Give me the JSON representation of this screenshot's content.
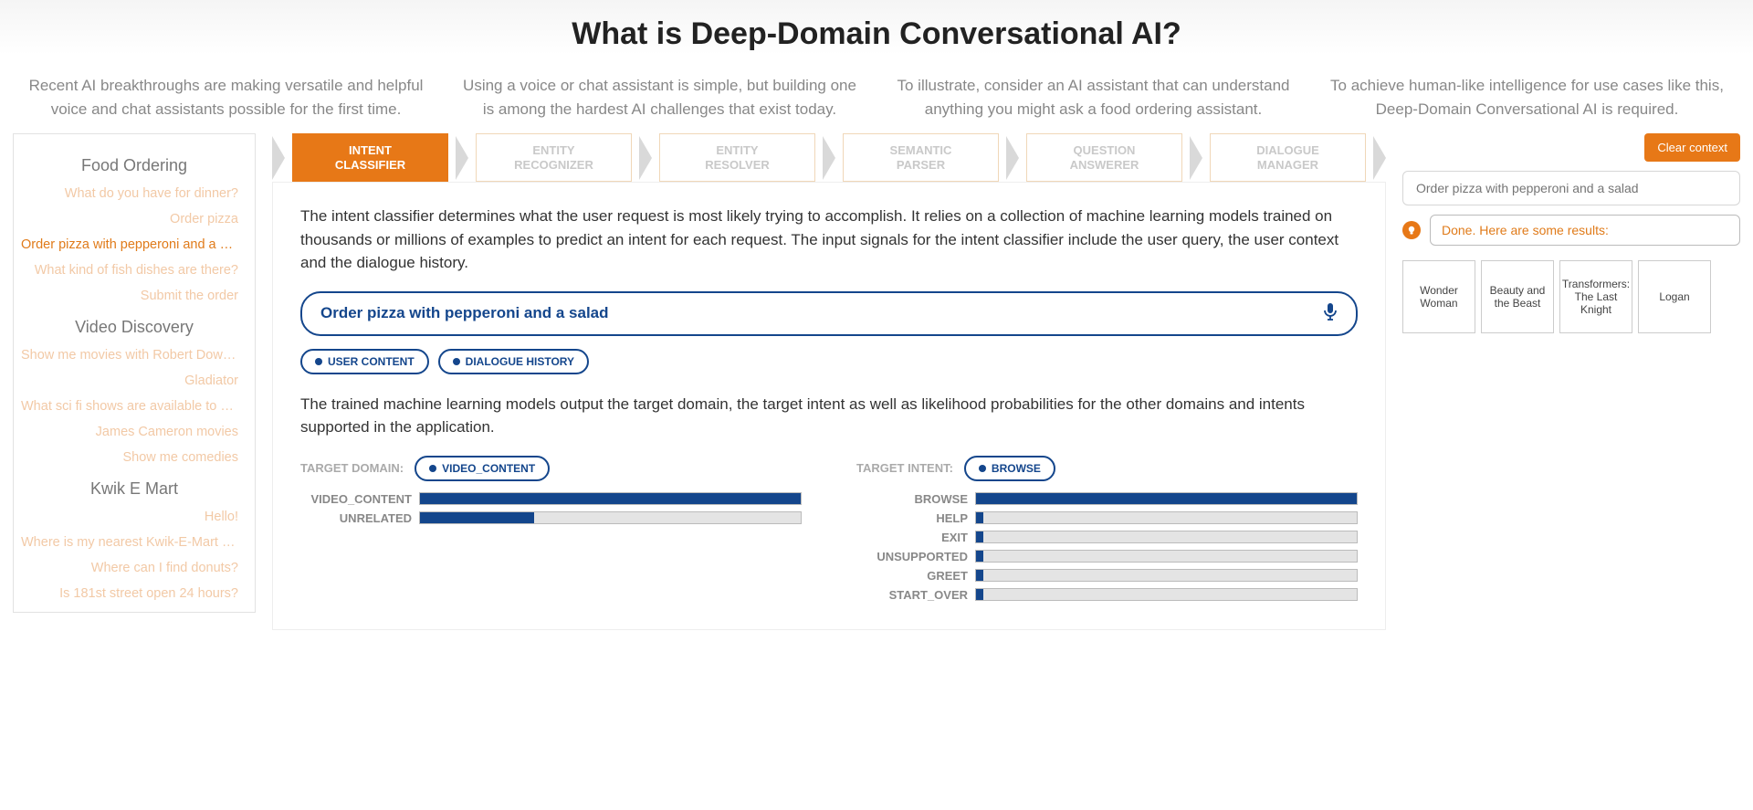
{
  "title": "What is Deep-Domain Conversational AI?",
  "intro": [
    "Recent AI breakthroughs are making versatile and helpful voice and chat assistants possible for the first time.",
    "Using a voice or chat assistant is simple, but building one is among the hardest AI challenges that exist today.",
    "To illustrate, consider an AI assistant that can understand anything you might ask a food ordering assistant.",
    "To achieve human-like intelligence for use cases like this, Deep-Domain Conversational AI is required."
  ],
  "sidebar": {
    "sections": [
      {
        "title": "Food Ordering",
        "items": [
          "What do you have for dinner?",
          "Order pizza",
          "Order pizza with pepperoni and a salad",
          "What kind of fish dishes are there?",
          "Submit the order"
        ],
        "active_index": 2
      },
      {
        "title": "Video Discovery",
        "items": [
          "Show me movies with Robert Downey Jr",
          "Gladiator",
          "What sci fi shows are available to watch?",
          "James Cameron movies",
          "Show me comedies"
        ]
      },
      {
        "title": "Kwik E Mart",
        "items": [
          "Hello!",
          "Where is my nearest Kwik-E-Mart store?",
          "Where can I find donuts?",
          "Is 181st street open 24 hours?"
        ]
      }
    ]
  },
  "pipeline": {
    "stages": [
      "INTENT CLASSIFIER",
      "ENTITY RECOGNIZER",
      "ENTITY RESOLVER",
      "SEMANTIC PARSER",
      "QUESTION ANSWERER",
      "DIALOGUE MANAGER"
    ],
    "active_index": 0
  },
  "panel": {
    "desc1": "The intent classifier determines what the user request is most likely trying to accomplish. It relies on a collection of machine learning models trained on thousands or millions of examples to predict an intent for each request. The input signals for the intent classifier include the user query, the user context and the dialogue history.",
    "query": "Order pizza with pepperoni and a salad",
    "pills": [
      "USER CONTENT",
      "DIALOGUE HISTORY"
    ],
    "desc2": "The trained machine learning models output the target domain, the target intent as well as likelihood probabilities for the other domains and intents supported in the application.",
    "target_domain_label": "TARGET DOMAIN:",
    "target_intent_label": "TARGET INTENT:",
    "target_domain_value": "VIDEO_CONTENT",
    "target_intent_value": "BROWSE"
  },
  "chart_data": [
    {
      "type": "bar",
      "title": "TARGET DOMAIN:",
      "xlabel": "",
      "ylabel": "",
      "ylim": [
        0,
        100
      ],
      "categories": [
        "VIDEO_CONTENT",
        "UNRELATED"
      ],
      "values": [
        100,
        30
      ]
    },
    {
      "type": "bar",
      "title": "TARGET INTENT:",
      "xlabel": "",
      "ylabel": "",
      "ylim": [
        0,
        100
      ],
      "categories": [
        "BROWSE",
        "HELP",
        "EXIT",
        "UNSUPPORTED",
        "GREET",
        "START_OVER"
      ],
      "values": [
        100,
        2,
        2,
        2,
        2,
        2
      ]
    }
  ],
  "right": {
    "clear_label": "Clear context",
    "input_placeholder": "Order pizza with pepperoni and a salad",
    "result_text": "Done. Here are some results:",
    "cards": [
      "Wonder Woman",
      "Beauty and the Beast",
      "Transformers: The Last Knight",
      "Logan"
    ]
  }
}
